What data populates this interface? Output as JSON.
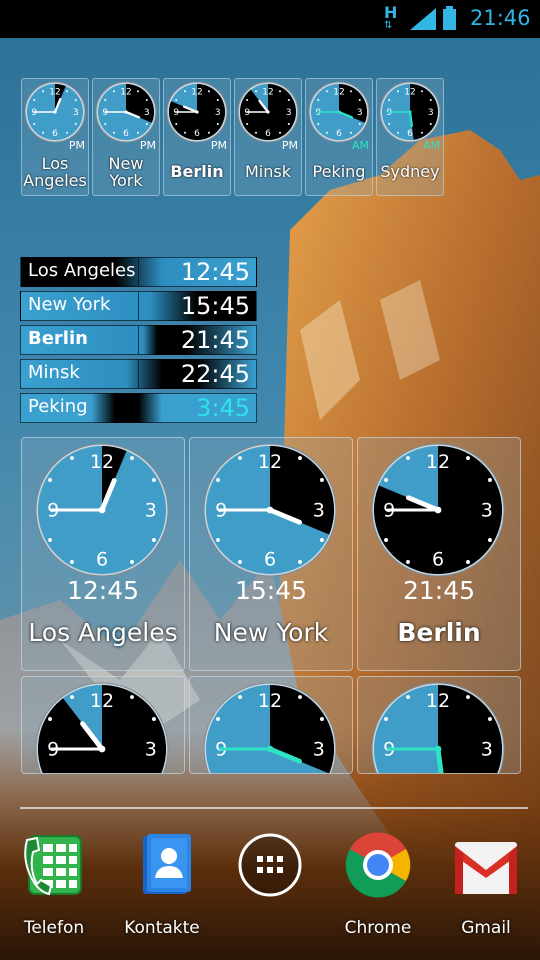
{
  "status": {
    "network": "H",
    "time": "21:46"
  },
  "mini_clocks": [
    {
      "city": "Los Angeles",
      "ampm": "PM"
    },
    {
      "city": "New York",
      "ampm": "PM"
    },
    {
      "city": "Berlin",
      "ampm": "PM"
    },
    {
      "city": "Minsk",
      "ampm": "PM"
    },
    {
      "city": "Peking",
      "ampm": "AM"
    },
    {
      "city": "Sydney",
      "ampm": "AM"
    }
  ],
  "digital_clocks": [
    {
      "city": "Los Angeles",
      "time": "12:45"
    },
    {
      "city": "New York",
      "time": "15:45"
    },
    {
      "city": "Berlin",
      "time": "21:45"
    },
    {
      "city": "Minsk",
      "time": "22:45"
    },
    {
      "city": "Peking",
      "time": "3:45"
    }
  ],
  "big_clocks": [
    {
      "city": "Los Angeles",
      "time": "12:45"
    },
    {
      "city": "New York",
      "time": "15:45"
    },
    {
      "city": "Berlin",
      "time": "21:45"
    }
  ],
  "dial_numbers": [
    "12",
    "3",
    "6",
    "9"
  ],
  "dock": [
    {
      "label": "Telefon",
      "icon": "phone-icon"
    },
    {
      "label": "Kontakte",
      "icon": "contacts-icon"
    },
    {
      "label": "",
      "icon": "app-drawer-icon"
    },
    {
      "label": "Chrome",
      "icon": "chrome-icon"
    },
    {
      "label": "Gmail",
      "icon": "gmail-icon"
    }
  ],
  "colors": {
    "dial": "#3f9dc8",
    "accent": "#33b5e5",
    "am_hands": "#2de3c6"
  }
}
